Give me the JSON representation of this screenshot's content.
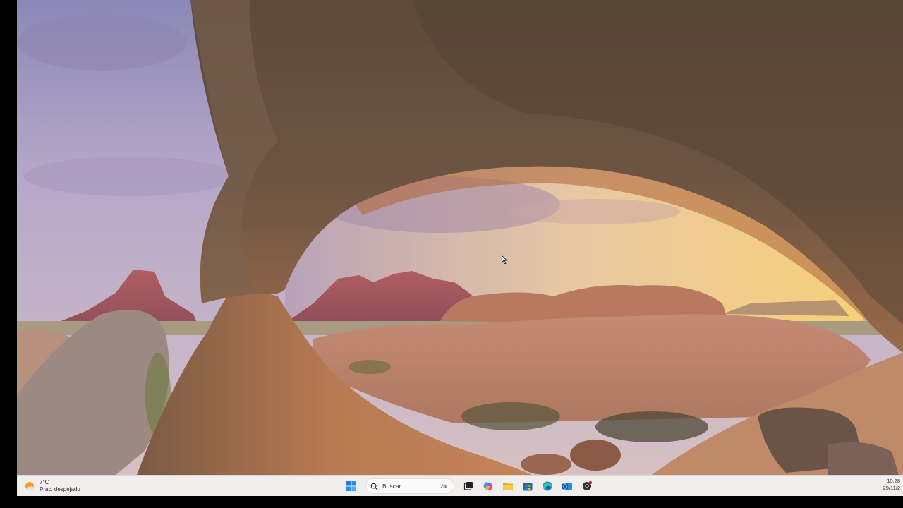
{
  "taskbar": {
    "weather": {
      "temperature": "7°C",
      "condition": "Prac. despejado",
      "icon": "partly-sunny-icon"
    },
    "search": {
      "placeholder": "Buscar",
      "icon": "search-icon"
    },
    "pinned_apps": [
      {
        "name": "start-icon"
      },
      {
        "name": "task-view-icon"
      },
      {
        "name": "copilot-icon"
      },
      {
        "name": "file-explorer-icon"
      },
      {
        "name": "microsoft-store-icon"
      },
      {
        "name": "edge-icon"
      },
      {
        "name": "outlook-icon"
      },
      {
        "name": "chrome-icon"
      }
    ],
    "clock": {
      "time": "10:28",
      "date": "29/11/2"
    }
  },
  "wallpaper": {
    "subject": "rock-arch-landscape"
  },
  "colors": {
    "taskbar_bg": "#f1eeee",
    "accent_blue": "#0a6cd6"
  }
}
